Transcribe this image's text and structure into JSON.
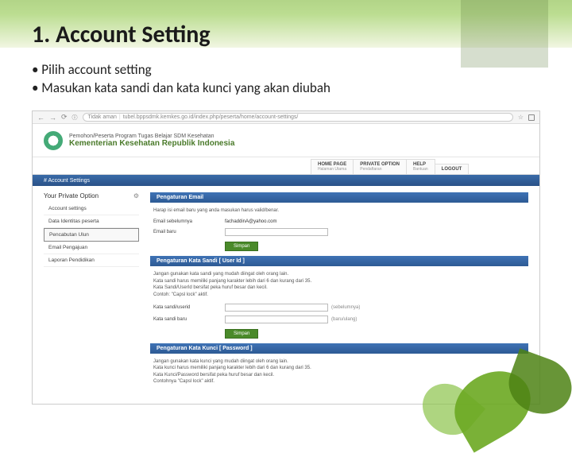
{
  "slide": {
    "title": "1. Account Setting",
    "bullets": [
      "• Pilih account setting",
      "• Masukan kata sandi dan kata kunci yang akan diubah"
    ]
  },
  "browser": {
    "security": "Tidak aman",
    "url": "tubel.bppsdmk.kemkes.go.id/index.php/peserta/home/account-settings/"
  },
  "header": {
    "line1": "Pemohon/Peserta Program Tugas Belajar SDM Kesehatan",
    "line2": "Kementerian Kesehatan Republik Indonesia"
  },
  "tabs": [
    {
      "label": "HOME PAGE",
      "sub": "Halaman Utama"
    },
    {
      "label": "PRIVATE OPTION",
      "sub": "Pendaftaran"
    },
    {
      "label": "HELP",
      "sub": "Bantuan"
    },
    {
      "label": "LOGOUT",
      "sub": ""
    }
  ],
  "breadcrumb": "# Account Settings",
  "sidebar": {
    "title": "Your Private Option",
    "items": [
      "Account settings",
      "Data Identitas peserta",
      "Pencabutan Ulun",
      "Email Pengajuan",
      "Laporan Pendidikan"
    ],
    "activeIndex": 2
  },
  "sections": {
    "email": {
      "header": "Pengaturan Email",
      "desc": "Harap isi email baru yang anda masukan harus valid/benar.",
      "rows": [
        {
          "label": "Email sebelumnya",
          "value": "fachaddinA@yahoo.com"
        },
        {
          "label": "Email baru",
          "input": true
        }
      ],
      "save": "Simpan"
    },
    "sandi": {
      "header": "Pengaturan Kata Sandi [ User Id ]",
      "desc": "Jangan gunakan kata sandi yang mudah diingat oleh orang lain.\nKata sandi harus memiliki panjang karakter lebih dari 6 dan kurang dari 35.\nKata Sandi/UserId bersifat peka huruf besar dan kecil.\nContoh: \"Capsl lock\" aktif.",
      "rows": [
        {
          "label": "Kata sandi/userid",
          "input": true,
          "extra": "(sebelumnya)"
        },
        {
          "label": "Kata sandi baru",
          "input": true,
          "extra": "(baru/ulang)"
        }
      ],
      "save": "Simpan"
    },
    "kunci": {
      "header": "Pengaturan Kata Kunci [ Password ]",
      "desc": "Jangan gunakan kata kunci yang mudah diingat oleh orang lain.\nKata kunci harus memiliki panjang karakter lebih dari 6 dan kurang dari 35.\nKata Kunci/Password bersifat peka huruf besar dan kecil.\nContohnya \"Capsl lock\" aktif."
    }
  }
}
